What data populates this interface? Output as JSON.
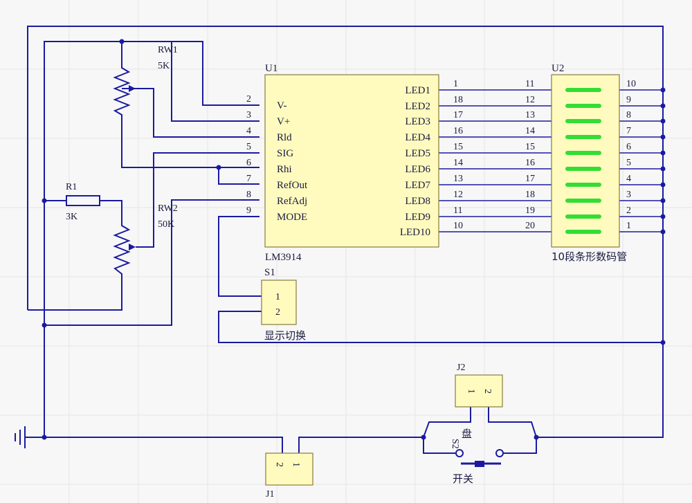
{
  "u1": {
    "designator": "U1",
    "part": "LM3914",
    "left_pins": [
      {
        "num": "2",
        "name": "V-"
      },
      {
        "num": "3",
        "name": "V+"
      },
      {
        "num": "4",
        "name": "Rld"
      },
      {
        "num": "5",
        "name": "SIG"
      },
      {
        "num": "6",
        "name": "Rhi"
      },
      {
        "num": "7",
        "name": "RefOut"
      },
      {
        "num": "8",
        "name": "RefAdj"
      },
      {
        "num": "9",
        "name": "MODE"
      }
    ],
    "right_pins": [
      {
        "num": "1",
        "name": "LED1"
      },
      {
        "num": "18",
        "name": "LED2"
      },
      {
        "num": "17",
        "name": "LED3"
      },
      {
        "num": "16",
        "name": "LED4"
      },
      {
        "num": "15",
        "name": "LED5"
      },
      {
        "num": "14",
        "name": "LED6"
      },
      {
        "num": "13",
        "name": "LED7"
      },
      {
        "num": "12",
        "name": "LED8"
      },
      {
        "num": "11",
        "name": "LED9"
      },
      {
        "num": "10",
        "name": "LED10"
      }
    ]
  },
  "u2": {
    "designator": "U2",
    "name": "10段条形数码管",
    "left_pins": [
      "11",
      "12",
      "13",
      "14",
      "15",
      "16",
      "17",
      "18",
      "19",
      "20"
    ],
    "right_pins": [
      "10",
      "9",
      "8",
      "7",
      "6",
      "5",
      "4",
      "3",
      "2",
      "1"
    ],
    "segment_color": "#33dd33"
  },
  "rw1": {
    "designator": "RW1",
    "value": "5K"
  },
  "rw2": {
    "designator": "RW2",
    "value": "50K"
  },
  "r1": {
    "designator": "R1",
    "value": "3K"
  },
  "s1": {
    "designator": "S1",
    "name": "显示切换",
    "pins": [
      "1",
      "2"
    ]
  },
  "j2": {
    "designator": "J2",
    "pins": [
      "1",
      "2"
    ]
  },
  "j1": {
    "designator": "J1",
    "pins": [
      "2",
      "1"
    ]
  },
  "s2": {
    "designator": "S2",
    "name": "开关",
    "extra_label": "盘"
  },
  "colors": {
    "wire": "#1a1aa0",
    "component_fill": "#fffbbf",
    "background": "#f7f7f7"
  }
}
